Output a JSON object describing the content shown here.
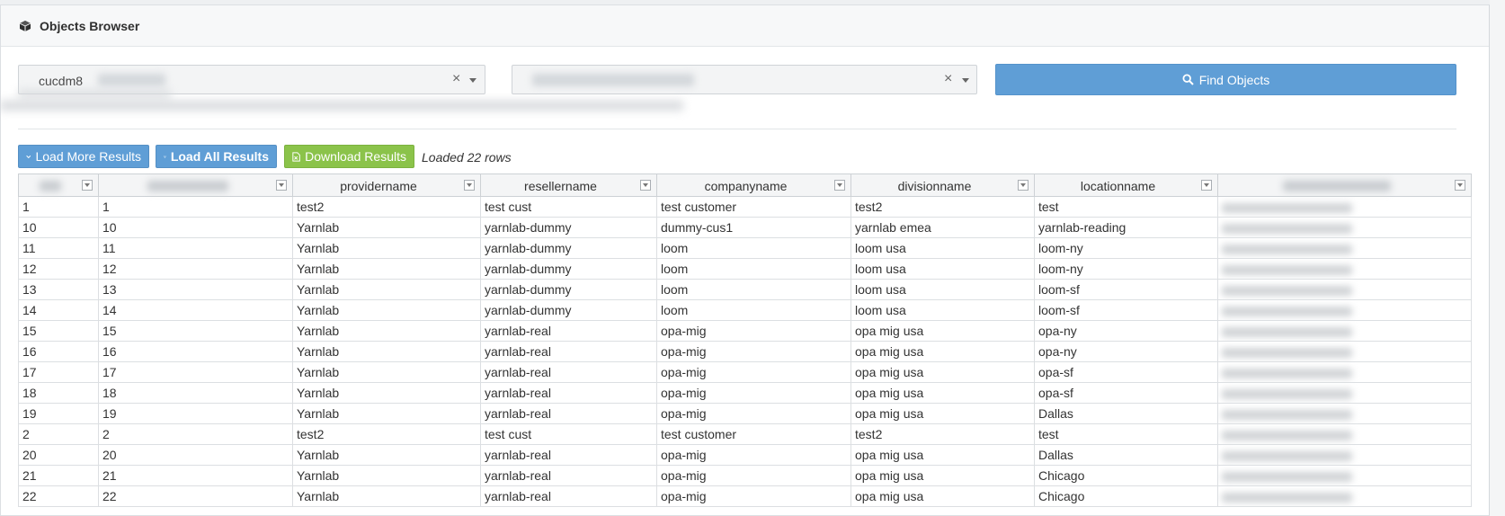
{
  "panel": {
    "title": "Objects Browser",
    "icon": "cube-icon"
  },
  "filters": {
    "server_value": "cucdm8",
    "clear_symbol": "×",
    "find_button_label": "Find Objects"
  },
  "actions": {
    "load_more_label": "Load More Results",
    "load_all_label": "Load All Results",
    "download_label": "Download Results",
    "status": "Loaded 22 rows"
  },
  "columns": [
    "",
    "",
    "providername",
    "resellername",
    "companyname",
    "divisionname",
    "locationname",
    ""
  ],
  "rows": [
    [
      "1",
      "1",
      "test2",
      "test cust",
      "test customer",
      "test2",
      "test"
    ],
    [
      "10",
      "10",
      "Yarnlab",
      "yarnlab-dummy",
      "dummy-cus1",
      "yarnlab emea",
      "yarnlab-reading"
    ],
    [
      "11",
      "11",
      "Yarnlab",
      "yarnlab-dummy",
      "loom",
      "loom usa",
      "loom-ny"
    ],
    [
      "12",
      "12",
      "Yarnlab",
      "yarnlab-dummy",
      "loom",
      "loom usa",
      "loom-ny"
    ],
    [
      "13",
      "13",
      "Yarnlab",
      "yarnlab-dummy",
      "loom",
      "loom usa",
      "loom-sf"
    ],
    [
      "14",
      "14",
      "Yarnlab",
      "yarnlab-dummy",
      "loom",
      "loom usa",
      "loom-sf"
    ],
    [
      "15",
      "15",
      "Yarnlab",
      "yarnlab-real",
      "opa-mig",
      "opa mig usa",
      "opa-ny"
    ],
    [
      "16",
      "16",
      "Yarnlab",
      "yarnlab-real",
      "opa-mig",
      "opa mig usa",
      "opa-ny"
    ],
    [
      "17",
      "17",
      "Yarnlab",
      "yarnlab-real",
      "opa-mig",
      "opa mig usa",
      "opa-sf"
    ],
    [
      "18",
      "18",
      "Yarnlab",
      "yarnlab-real",
      "opa-mig",
      "opa mig usa",
      "opa-sf"
    ],
    [
      "19",
      "19",
      "Yarnlab",
      "yarnlab-real",
      "opa-mig",
      "opa mig usa",
      "Dallas"
    ],
    [
      "2",
      "2",
      "test2",
      "test cust",
      "test customer",
      "test2",
      "test"
    ],
    [
      "20",
      "20",
      "Yarnlab",
      "yarnlab-real",
      "opa-mig",
      "opa mig usa",
      "Dallas"
    ],
    [
      "21",
      "21",
      "Yarnlab",
      "yarnlab-real",
      "opa-mig",
      "opa mig usa",
      "Chicago"
    ],
    [
      "22",
      "22",
      "Yarnlab",
      "yarnlab-real",
      "opa-mig",
      "opa mig usa",
      "Chicago"
    ]
  ],
  "colors": {
    "primary": "#5f9ed6",
    "success": "#8bc34a"
  }
}
